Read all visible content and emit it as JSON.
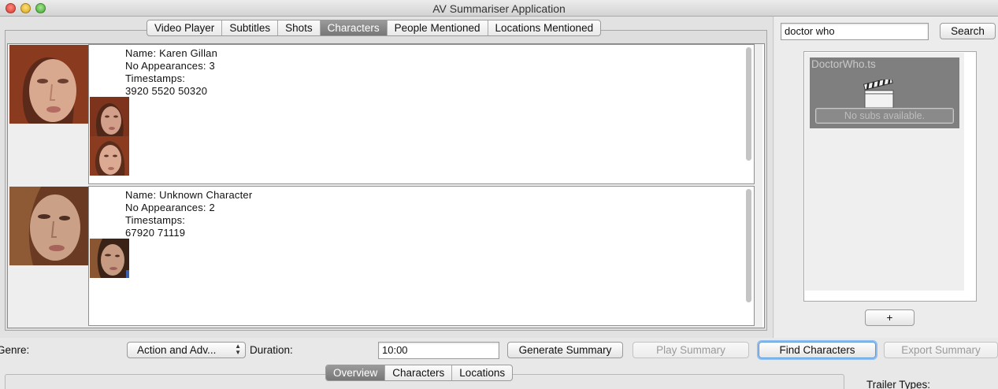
{
  "window": {
    "title": "AV Summariser Application"
  },
  "top_tabs": [
    {
      "label": "Video Player",
      "active": false
    },
    {
      "label": "Subtitles",
      "active": false
    },
    {
      "label": "Shots",
      "active": false
    },
    {
      "label": "Characters",
      "active": true
    },
    {
      "label": "People Mentioned",
      "active": false
    },
    {
      "label": "Locations Mentioned",
      "active": false
    }
  ],
  "characters": [
    {
      "name_line": "Name: Karen Gillan",
      "appearances_line": "No Appearances: 3",
      "timestamps_label": "Timestamps:",
      "timestamps": "3920 5520 50320",
      "thumbnail_count": 2
    },
    {
      "name_line": "Name: Unknown Character",
      "appearances_line": "No Appearances: 2",
      "timestamps_label": "Timestamps:",
      "timestamps": "67920 71119",
      "thumbnail_count": 1
    }
  ],
  "search": {
    "value": "doctor who",
    "button_label": "Search"
  },
  "file_list": {
    "items": [
      {
        "filename": "DoctorWho.ts",
        "subs_status": "No subs available."
      }
    ],
    "add_button_label": "+"
  },
  "controls": {
    "genre_label": "Genre:",
    "genre_value": "Action and Adv...",
    "duration_label": "Duration:",
    "duration_value": "10:00",
    "generate_summary_label": "Generate Summary",
    "play_summary_label": "Play Summary",
    "find_characters_label": "Find Characters",
    "export_summary_label": "Export Summary",
    "trailer_types_label": "Trailer Types:"
  },
  "bottom_tabs": [
    {
      "label": "Overview",
      "active": true
    },
    {
      "label": "Characters",
      "active": false
    },
    {
      "label": "Locations",
      "active": false
    }
  ],
  "colors": {
    "active_tab": "#888888",
    "focus_ring": "#8fbdf0"
  }
}
